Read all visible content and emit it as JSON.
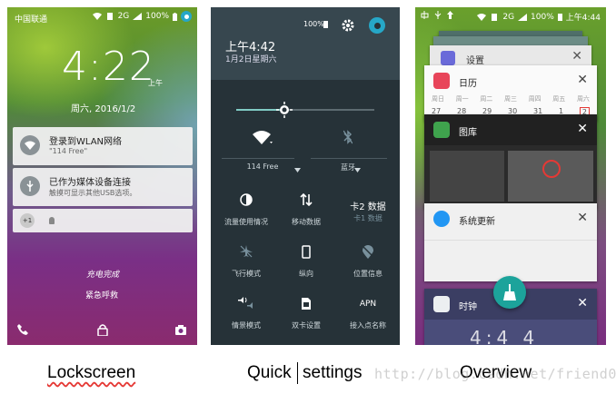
{
  "lockscreen": {
    "carrier": "中国联通",
    "signal": "2G",
    "battery": "100%",
    "clock": "4:22",
    "ampm": "上午",
    "date": "周六, 2016/1/2",
    "notifications": [
      {
        "title": "登录到WLAN网络",
        "subtitle": "\"114 Free\"",
        "icon": "wifi-icon"
      },
      {
        "title": "已作为媒体设备连接",
        "subtitle": "触摸可显示其他USB选项。",
        "icon": "usb-icon"
      }
    ],
    "more_count": "+1",
    "charged": "充电完成",
    "emergency": "紧急呼救"
  },
  "quick_settings": {
    "battery": "100%",
    "time": "上午4:42",
    "date": "1月2日星期六",
    "brightness": 0.35,
    "wifi_label": "114 Free",
    "bluetooth_label": "蓝牙",
    "tiles": [
      {
        "label": "流量使用情况"
      },
      {
        "label": "移动数据"
      },
      {
        "big": "卡2 数据",
        "sub": "卡1 数据"
      },
      {
        "label": "飞行模式"
      },
      {
        "label": "纵向"
      },
      {
        "label": "位置信息"
      },
      {
        "label": "情景模式"
      },
      {
        "label": "双卡设置"
      },
      {
        "big": "APN",
        "label": "接入点名称"
      }
    ]
  },
  "overview": {
    "signal": "2G",
    "battery": "100%",
    "time": "上午4:44",
    "cards": [
      {
        "title": "设置"
      },
      {
        "title": "日历"
      },
      {
        "title": "图库"
      },
      {
        "title": "系统更新"
      },
      {
        "title": "时钟"
      }
    ],
    "calendar_weekdays": [
      "周日",
      "周一",
      "周二",
      "周三",
      "周四",
      "周五",
      "周六"
    ],
    "calendar_days": [
      "27",
      "28",
      "29",
      "30",
      "31",
      "1",
      "2"
    ],
    "clock_digits": "4:4 4"
  },
  "captions": {
    "lockscreen": "Lockscreen",
    "quick": "Quick",
    "settings": "settings",
    "overview": "Overview"
  },
  "watermark": "http://blog.csdn.net/friend0"
}
